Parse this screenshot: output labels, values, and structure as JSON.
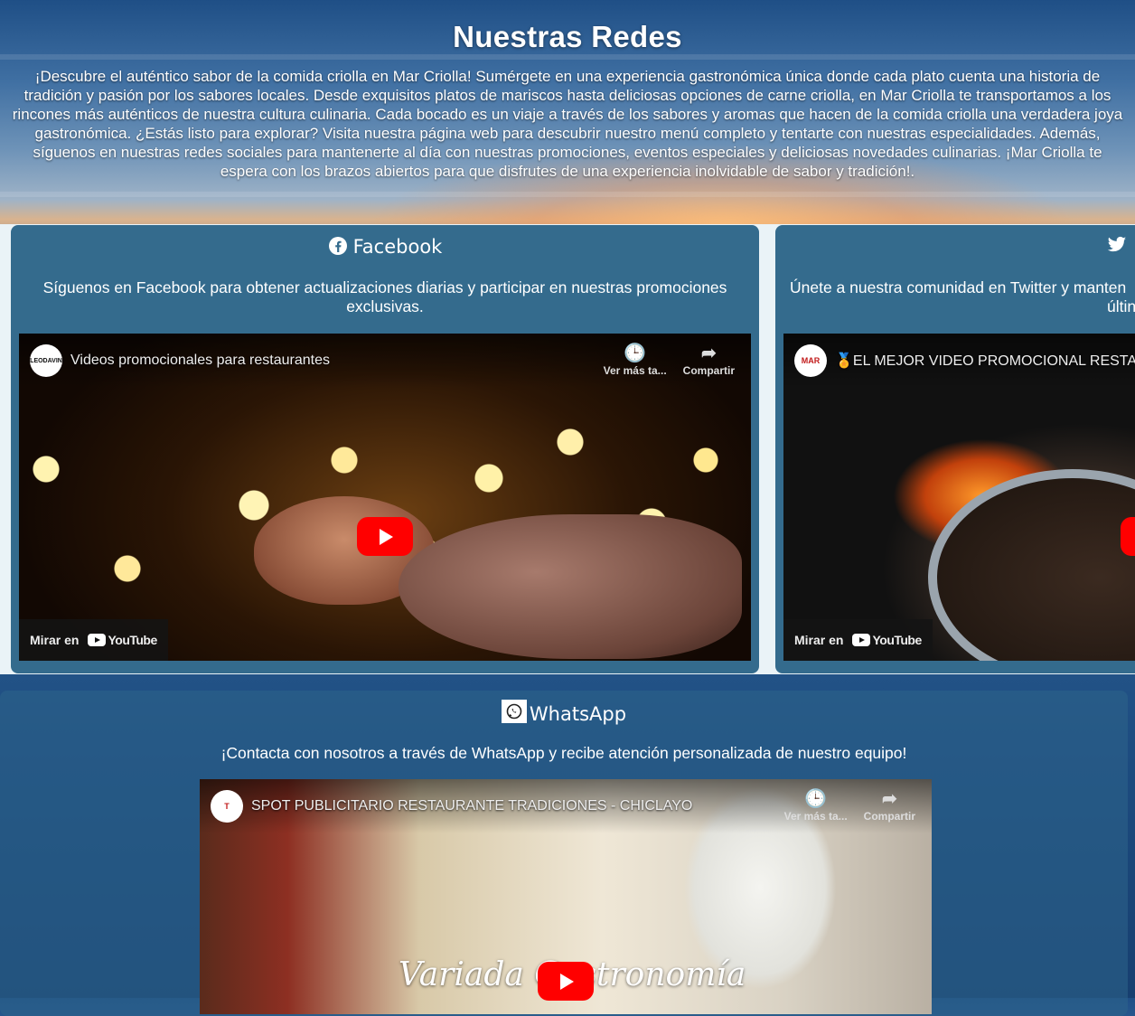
{
  "header": {
    "title": "Nuestras Redes",
    "intro": "¡Descubre el auténtico sabor de la comida criolla en Mar Criolla! Sumérgete en una experiencia gastronómica única donde cada plato cuenta una historia de tradición y pasión por los sabores locales. Desde exquisitos platos de mariscos hasta deliciosas opciones de carne criolla, en Mar Criolla te transportamos a los rincones más auténticos de nuestra cultura culinaria. Cada bocado es un viaje a través de los sabores y aromas que hacen de la comida criolla una verdadera joya gastronómica. ¿Estás listo para explorar? Visita nuestra página web para descubrir nuestro menú completo y tentarte con nuestras especialidades. Además, síguenos en nuestras redes sociales para mantenerte al día con nuestras promociones, eventos especiales y deliciosas novedades culinarias. ¡Mar Criolla te espera con los brazos abiertos para que disfrutes de una experiencia inolvidable de sabor y tradición!."
  },
  "cards": {
    "facebook": {
      "icon": "facebook-icon",
      "title": "Facebook",
      "description": "Síguenos en Facebook para obtener actualizaciones diarias y participar en nuestras promociones exclusivas.",
      "video": {
        "channel_avatar_text": "LEODAVIN",
        "title": "Videos promocionales para restaurantes",
        "watch_later": "Ver más ta...",
        "share": "Compartir",
        "watch_on": "Mirar en",
        "youtube": "YouTube"
      }
    },
    "twitter": {
      "icon": "twitter-icon",
      "title": "",
      "description": "Únete a nuestra comunidad en Twitter y manten",
      "description_line2": "últin",
      "video": {
        "channel_avatar_text": "MAR",
        "title": "🏅EL MEJOR VIDEO PROMOCIONAL RESTAUR",
        "watch_on": "Mirar en",
        "youtube": "YouTube"
      }
    },
    "whatsapp": {
      "icon": "whatsapp-icon",
      "title": "WhatsApp",
      "description": "¡Contacta con nosotros a través de WhatsApp y recibe atención personalizada de nuestro equipo!",
      "video": {
        "channel_avatar_text": "T",
        "title": "SPOT PUBLICITARIO RESTAURANTE TRADICIONES - CHICLAYO",
        "watch_later": "Ver más ta...",
        "share": "Compartir",
        "overlay_text": "Variada Gastronomía"
      }
    }
  },
  "colors": {
    "card": "#346b8d",
    "youtube_red": "#ff0000"
  }
}
